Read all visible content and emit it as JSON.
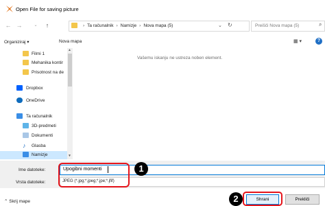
{
  "window": {
    "title": "Open File for saving picture"
  },
  "address": {
    "crumbs": [
      "Ta računalnik",
      "Namizje",
      "Nova mapa (5)"
    ],
    "search_placeholder": "Preišči Nova mapa (5)"
  },
  "toolbar": {
    "organize": "Organiziraj ▾",
    "new_folder": "Nova mapa"
  },
  "nav": [
    {
      "label": "Filmi 1",
      "icon": "folder-icon"
    },
    {
      "label": "Mehanika kontir",
      "icon": "folder-icon"
    },
    {
      "label": "Prisotnost na de",
      "icon": "folder-icon"
    },
    {
      "label": "Dropbox",
      "icon": "dropbox-icon"
    },
    {
      "label": "OneDrive",
      "icon": "onedrive-icon"
    },
    {
      "label": "Ta računalnik",
      "icon": "computer-icon"
    },
    {
      "label": "3D-predmeti",
      "icon": "3d-objects-icon"
    },
    {
      "label": "Dokumenti",
      "icon": "documents-icon"
    },
    {
      "label": "Glasba",
      "icon": "music-icon"
    },
    {
      "label": "Namizje",
      "icon": "desktop-icon"
    }
  ],
  "main": {
    "empty_message": "Vašemu iskanju ne ustreza noben element."
  },
  "fields": {
    "filename_label": "Ime datoteke:",
    "filename_value": "Upogibni momenti",
    "filetype_label": "Vrsta datoteke:",
    "filetype_value": "JPEG (*.jpg;*.jpeg;*.jpe;*.jfif)"
  },
  "footer": {
    "hide_folders": "Skrij mape",
    "save": "Shrani",
    "cancel": "Prekliči"
  },
  "annotations": {
    "badge1": "1",
    "badge2": "2"
  },
  "colors": {
    "accent": "#0078d7",
    "highlight": "#e5141b",
    "selected": "#cce8ff"
  }
}
